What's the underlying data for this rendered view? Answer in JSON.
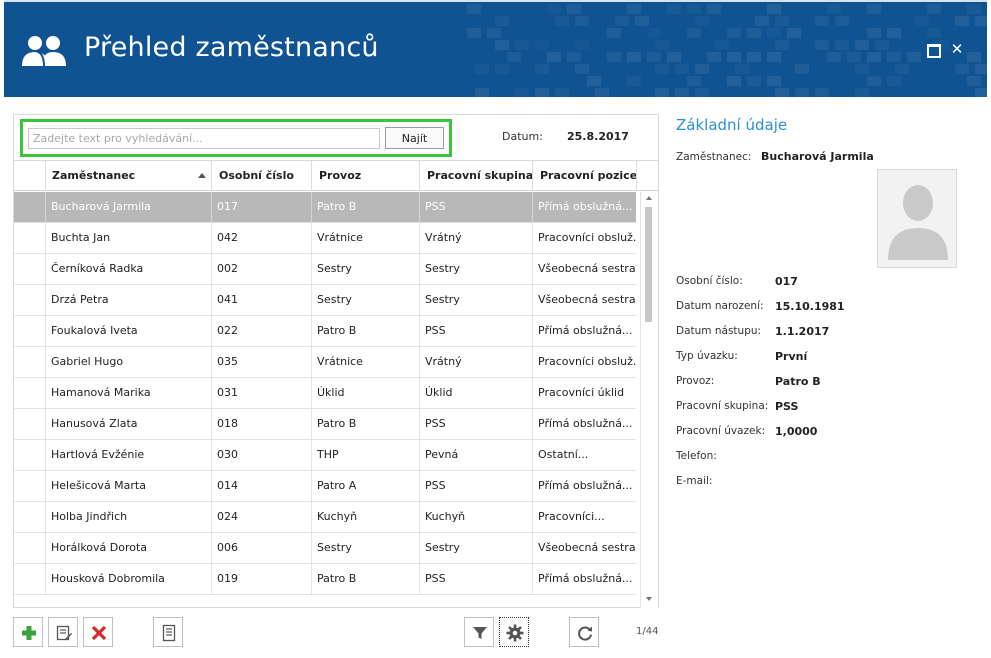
{
  "window": {
    "title": "Přehled zaměstnanců",
    "icon": "users-icon",
    "controls": [
      "maximize-icon",
      "close-icon"
    ],
    "accent_color": "#0f5392"
  },
  "search": {
    "placeholder": "Zadejte text pro vyhledávání...",
    "value": "",
    "button_label": "Najít",
    "highlight_color": "#3cc43c"
  },
  "date": {
    "label": "Datum:",
    "value": "25.8.2017"
  },
  "grid": {
    "columns": [
      "Zaměstnanec",
      "Osobní číslo",
      "Provoz",
      "Pracovní skupina",
      "Pracovní pozice"
    ],
    "sorted_column": "Zaměstnanec",
    "sort_direction": "ascending",
    "selected_index": 0,
    "rows": [
      [
        "Bucharová Jarmila",
        "017",
        "Patro B",
        "PSS",
        "Přímá obslužná..."
      ],
      [
        "Buchta Jan",
        "042",
        "Vrátnice",
        "Vrátný",
        "Pracovníci obsluž..."
      ],
      [
        "Černíková Radka",
        "002",
        "Sestry",
        "Sestry",
        "Všeobecná sestra"
      ],
      [
        "Drzá Petra",
        "041",
        "Sestry",
        "Sestry",
        "Všeobecná sestra"
      ],
      [
        "Foukalová Iveta",
        "022",
        "Patro B",
        "PSS",
        "Přímá obslužná..."
      ],
      [
        "Gabriel Hugo",
        "035",
        "Vrátnice",
        "Vrátný",
        "Pracovníci obsluž..."
      ],
      [
        "Hamanová Marika",
        "031",
        "Úklid",
        "Úklid",
        "Pracovníci úklid"
      ],
      [
        "Hanusová Zlata",
        "018",
        "Patro B",
        "PSS",
        "Přímá obslužná..."
      ],
      [
        "Hartlová Evžénie",
        "030",
        "THP",
        "Pevná",
        "Ostatní..."
      ],
      [
        "Helešicová Marta",
        "014",
        "Patro A",
        "PSS",
        "Přímá obslužná..."
      ],
      [
        "Holba Jindřich",
        "024",
        "Kuchyň",
        "Kuchyň",
        "Pracovníci..."
      ],
      [
        "Horálková Dorota",
        "006",
        "Sestry",
        "Sestry",
        "Všeobecná sestra"
      ],
      [
        "Housková Dobromila",
        "019",
        "Patro B",
        "PSS",
        "Přímá obslužná..."
      ]
    ]
  },
  "toolbar": {
    "buttons": [
      "add-icon",
      "edit-icon",
      "delete-icon",
      "report-icon",
      "filter-icon",
      "settings-icon",
      "refresh-icon"
    ],
    "page_counter": "1/44"
  },
  "details": {
    "title": "Základní údaje",
    "employee_label": "Zaměstnanec:",
    "employee_name": "Bucharová Jarmila",
    "photo_icon": "person-silhouette-icon",
    "fields": [
      {
        "label": "Osobní číslo:",
        "value": "017"
      },
      {
        "label": "Datum narození:",
        "value": "15.10.1981"
      },
      {
        "label": "Datum nástupu:",
        "value": "1.1.2017"
      },
      {
        "label": "Typ úvazku:",
        "value": "První"
      },
      {
        "label": "Provoz:",
        "value": "Patro B"
      },
      {
        "label": "Pracovní skupina:",
        "value": "PSS"
      },
      {
        "label": "Pracovní úvazek:",
        "value": "1,0000"
      },
      {
        "label": "Telefon:",
        "value": ""
      },
      {
        "label": "E-mail:",
        "value": ""
      }
    ]
  }
}
